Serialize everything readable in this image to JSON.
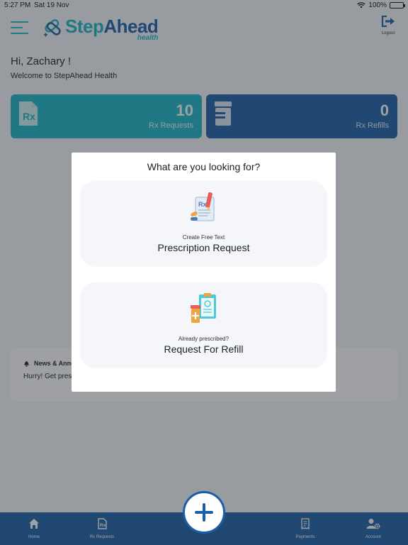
{
  "status_bar": {
    "time": "5:27 PM",
    "date": "Sat 19 Nov",
    "battery": "100%"
  },
  "header": {
    "logo_main_1": "Step",
    "logo_main_2": "Ahead",
    "logo_sub": "health",
    "logout_label": "Logout"
  },
  "greeting": "Hi, Zachary !",
  "welcome": "Welcome to StepAhead Health",
  "cards": {
    "requests": {
      "count": "10",
      "label": "Rx Requests"
    },
    "refills": {
      "count": "0",
      "label": "Rx Refills"
    }
  },
  "news": {
    "title": "News & Anno",
    "text": "Hurry! Get presc"
  },
  "modal": {
    "title": "What are you looking for?",
    "options": [
      {
        "sub": "Create Free Text",
        "main": "Prescription Request"
      },
      {
        "sub": "Already prescribed?",
        "main": "Request For Refill"
      }
    ]
  },
  "bottom_nav": {
    "home": "Home",
    "rx_requests": "Rx Requests",
    "payments": "Payments",
    "account": "Account"
  },
  "colors": {
    "teal": "#1ab6c8",
    "blue": "#1a5fa6",
    "overlay": "rgba(40,44,50,0.45)"
  },
  "icons": [
    "hamburger-icon",
    "logo-icon",
    "logout-icon",
    "rx-document-icon",
    "pill-bottle-icon",
    "bell-icon",
    "prescription-pen-icon",
    "clipboard-medicine-icon",
    "home-icon",
    "rx-file-icon",
    "plus-icon",
    "receipt-icon",
    "account-settings-icon",
    "wifi-icon",
    "battery-icon"
  ]
}
